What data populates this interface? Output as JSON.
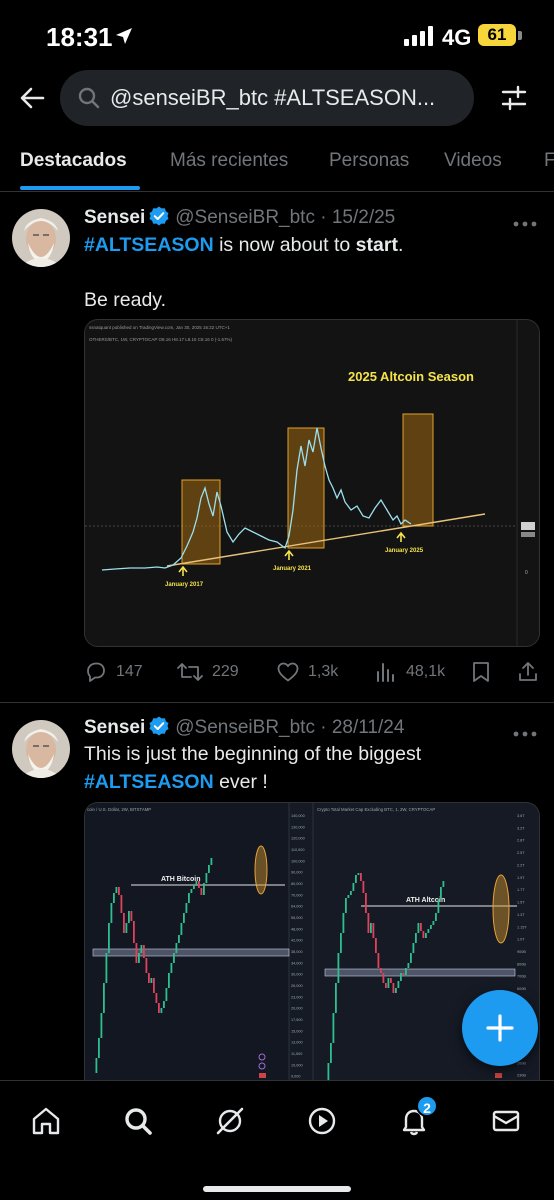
{
  "status_bar": {
    "time": "18:31",
    "network": "4G",
    "battery": "61"
  },
  "search": {
    "query": "@senseiBR_btc #ALTSEASON..."
  },
  "tabs": [
    {
      "label": "Destacados",
      "active": true
    },
    {
      "label": "Más recientes"
    },
    {
      "label": "Personas"
    },
    {
      "label": "Videos"
    },
    {
      "label": "F"
    }
  ],
  "tweets": [
    {
      "name": "Sensei",
      "handle": "@SenseiBR_btc",
      "date": "15/2/25",
      "hashtag": "#ALTSEASON",
      "text_middle": " is now about to ",
      "text_bold": "start",
      "text_end": ".",
      "text_line2": "Be ready.",
      "chart": {
        "title": "2025 Altcoin Season",
        "labels": [
          "January 2017",
          "January 2021",
          "January 2025"
        ],
        "header_line1": "ssnatquant published on TradingView.com, Jan 30, 2025 16:22 UTC+1",
        "header_line2": "OTHERS/BTC, 1W, CRYPTOCAP  O8.16  H8.17  L8.15  C8.16  0 (-1.67%)"
      },
      "stats": {
        "replies": "147",
        "reposts": "229",
        "likes": "1,3k",
        "views": "48,1k"
      }
    },
    {
      "name": "Sensei",
      "handle": "@SenseiBR_btc",
      "date": "28/11/24",
      "text_line1": "This is just the beginning of the biggest",
      "hashtag": "#ALTSEASON",
      "text_end": " ever !",
      "charts": [
        {
          "header": "coin / U.S. Dollar, 2W, BITSTAMP",
          "label": "ATH Bitcoin",
          "axis": [
            "140,000",
            "130,000",
            "120,000",
            "110,000",
            "100,000",
            "90,000",
            "80,000",
            "70,000",
            "64,000",
            "56,000",
            "48,000",
            "42,000",
            "38,000",
            "34,000",
            "30,000",
            "26,000",
            "23,000",
            "20,000",
            "17,500",
            "15,000",
            "13,000",
            "11,500",
            "10,000",
            "9,000",
            "8,000"
          ]
        },
        {
          "header": "Crypto Total Market Cap Excluding BTC, 1, 2W, CRYPTOCAP",
          "label": "ATH Altcoin",
          "axis": [
            "3.6T",
            "3.2T",
            "2.8T",
            "2.5T",
            "2.2T",
            "1.9T",
            "1.7T",
            "1.5T",
            "1.3T",
            "1.15T",
            "1.0T",
            "900B",
            "800B",
            "700B",
            "600B",
            "520B",
            "450B",
            "400B",
            "350B",
            "300B",
            "260B",
            "230B",
            "200B"
          ]
        }
      ]
    }
  ],
  "nav": {
    "notifications_badge": "2"
  }
}
